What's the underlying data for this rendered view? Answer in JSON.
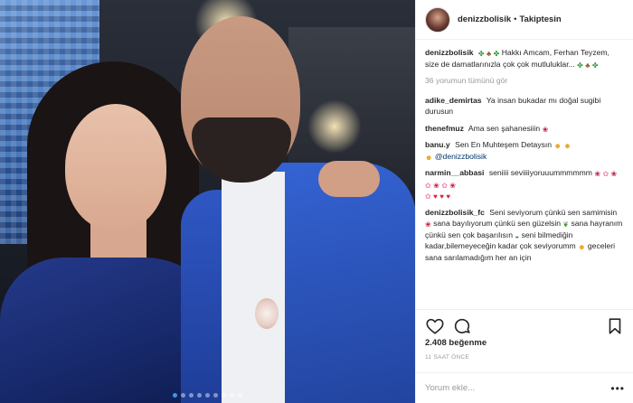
{
  "post": {
    "username": "denizzbolisik",
    "separator": "•",
    "follow_label": "Takiptesin",
    "caption": "Hakkı Amcam, Ferhan Teyzem, size de damatlarınızla çok çok mutluluklar...",
    "view_comments": "36 yorumun tümünü gör",
    "likes_count": "2.408",
    "likes_label": "beğenme",
    "time": "11 SAAT ÖNCE",
    "comment_placeholder": "Yorum ekle...",
    "more_label": "•••",
    "carousel_dots": 9,
    "carousel_active": 0
  },
  "comments": [
    {
      "user": "adike_demirtas",
      "text": "Ya insan bukadar mı doğal sugibi durusun"
    },
    {
      "user": "thenefmuz",
      "text": "Ama sen şahanesiiin"
    },
    {
      "user": "banu.y",
      "text": "Sen En Muhteşem Detaysın",
      "mention": "@denizzbolisik"
    },
    {
      "user": "narmin__abbasi",
      "text": "seniiii seviiiiyoruuummmmmm"
    },
    {
      "user": "denizzbolisik_fc",
      "parts": [
        "Seni seviyorum çünkü sen samimisin",
        "sana bayılıyorum çünkü sen güzelsin",
        "sana hayranım çünkü sen çok başarılısın",
        "seni bilmediğin kadar,bilemeyeceğin kadar çok seviyorumm",
        "geceleri sana sarılamadığım her an için"
      ]
    }
  ],
  "icons": {
    "like": "heart-outline-icon",
    "comment": "speech-bubble-icon",
    "save": "bookmark-icon",
    "clover": "four-leaf-clover-icon",
    "tree": "tree-icon",
    "heart": "heart-icon",
    "rose": "rose-icon",
    "blossom": "blossom-icon",
    "smile": "heart-eyes-face-icon"
  },
  "colors": {
    "mention": "#003569",
    "muted": "#999999",
    "text": "#262626",
    "active_dot": "#3897f0"
  }
}
